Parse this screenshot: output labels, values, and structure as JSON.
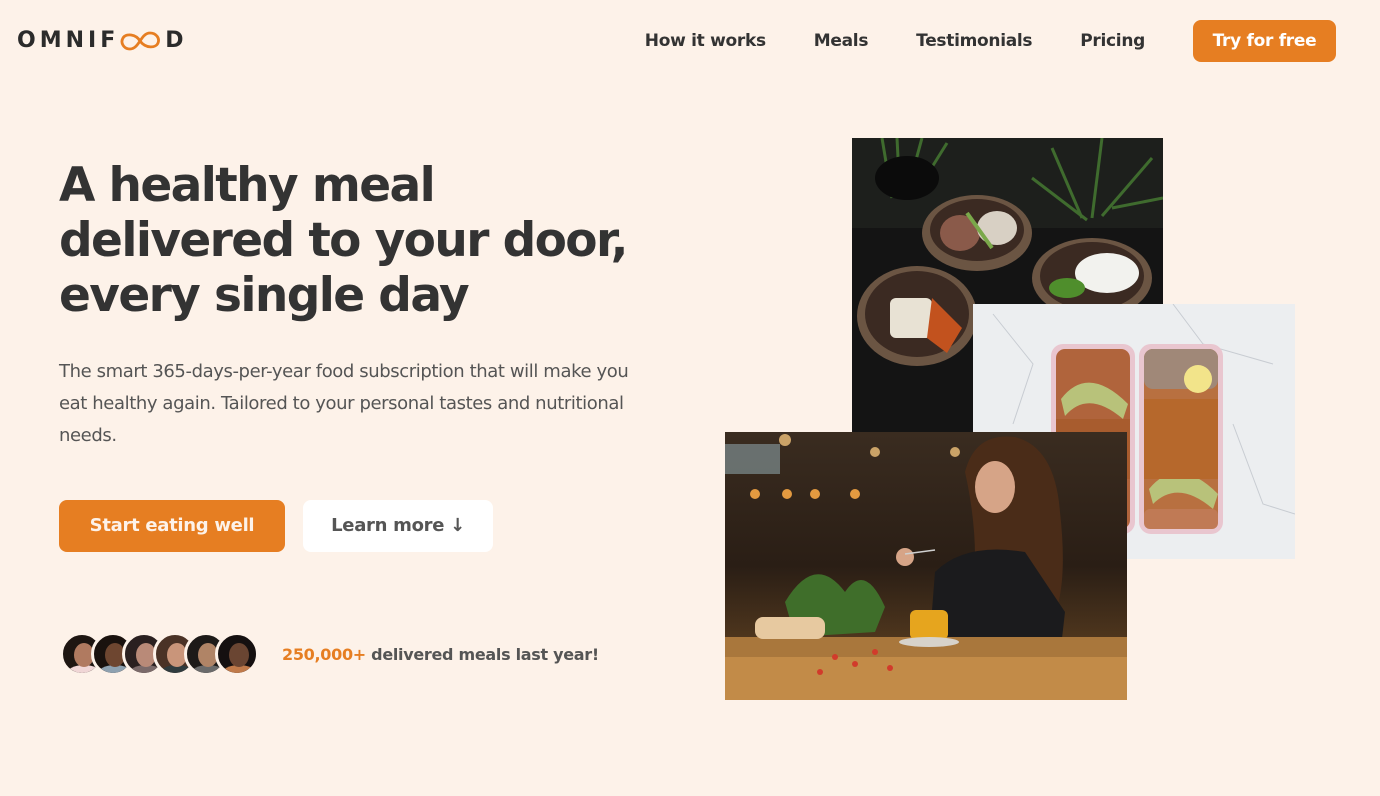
{
  "brand": {
    "logo_text_before": "OMNIF",
    "logo_text_after": "D",
    "logo_icon": "infinity-icon",
    "accent_color": "#e67e22",
    "background_color": "#fdf2e9",
    "text_color": "#333333"
  },
  "nav": {
    "items": [
      {
        "label": "How it works"
      },
      {
        "label": "Meals"
      },
      {
        "label": "Testimonials"
      },
      {
        "label": "Pricing"
      }
    ],
    "cta_label": "Try for free"
  },
  "hero": {
    "title_lines": [
      "A healthy meal",
      "delivered to your door,",
      "every single day"
    ],
    "description": "The smart 365-days-per-year food subscription that will make you eat healthy again. Tailored to your personal tastes and nutritional needs.",
    "primary_button": "Start eating well",
    "secondary_button": "Learn more ↓",
    "delivered": {
      "count": "250,000+",
      "text": " delivered meals last year!",
      "avatars": [
        {
          "name": "customer-1",
          "skin": "#b07a60",
          "hair": "#1e1612",
          "shirt": "#f0d6d6"
        },
        {
          "name": "customer-2",
          "skin": "#6e4630",
          "hair": "#1a120e",
          "shirt": "#8ea1b0"
        },
        {
          "name": "customer-3",
          "skin": "#b98a78",
          "hair": "#2a2020",
          "shirt": "#7b6a6a"
        },
        {
          "name": "customer-4",
          "skin": "#c9957a",
          "hair": "#4a3226",
          "shirt": "#2f3b3e"
        },
        {
          "name": "customer-5",
          "skin": "#b08466",
          "hair": "#1d1a18",
          "shirt": "#6b6b6b"
        },
        {
          "name": "customer-6",
          "skin": "#6a4532",
          "hair": "#151010",
          "shirt": "#c07a4a"
        }
      ]
    }
  },
  "images": [
    {
      "name": "hero-image-bowls",
      "alt": "Bowls of healthy meals on a dark table"
    },
    {
      "name": "hero-image-meal-prep",
      "alt": "Meal prep boxes with chickpeas and avocado"
    },
    {
      "name": "hero-image-woman-eating",
      "alt": "Woman enjoying a meal in a cafe"
    }
  ]
}
